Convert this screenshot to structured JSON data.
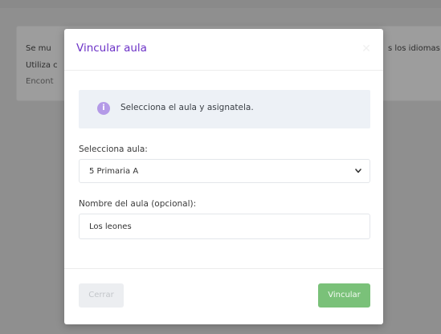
{
  "background": {
    "line1": "Se mu",
    "line2": "Utiliza c",
    "line3": "Encont",
    "line1_right": "s los idiomas"
  },
  "modal": {
    "title": "Vincular aula",
    "close_icon": "close-icon",
    "info": {
      "icon": "info-icon",
      "icon_glyph": "i",
      "text": "Selecciona el aula y asignatela."
    },
    "select_label": "Selecciona aula:",
    "select_value": "5 Primaria A",
    "name_label": "Nombre del aula (opcional):",
    "name_value": "Los leones",
    "cancel_label": "Cerrar",
    "submit_label": "Vincular"
  },
  "colors": {
    "accent": "#6d33c7",
    "info_bg": "#edf1f6",
    "info_icon": "#b49ae7",
    "submit_bg": "#7ac179",
    "cancel_bg": "#eceef1",
    "overlay": "#8f8f8f"
  }
}
